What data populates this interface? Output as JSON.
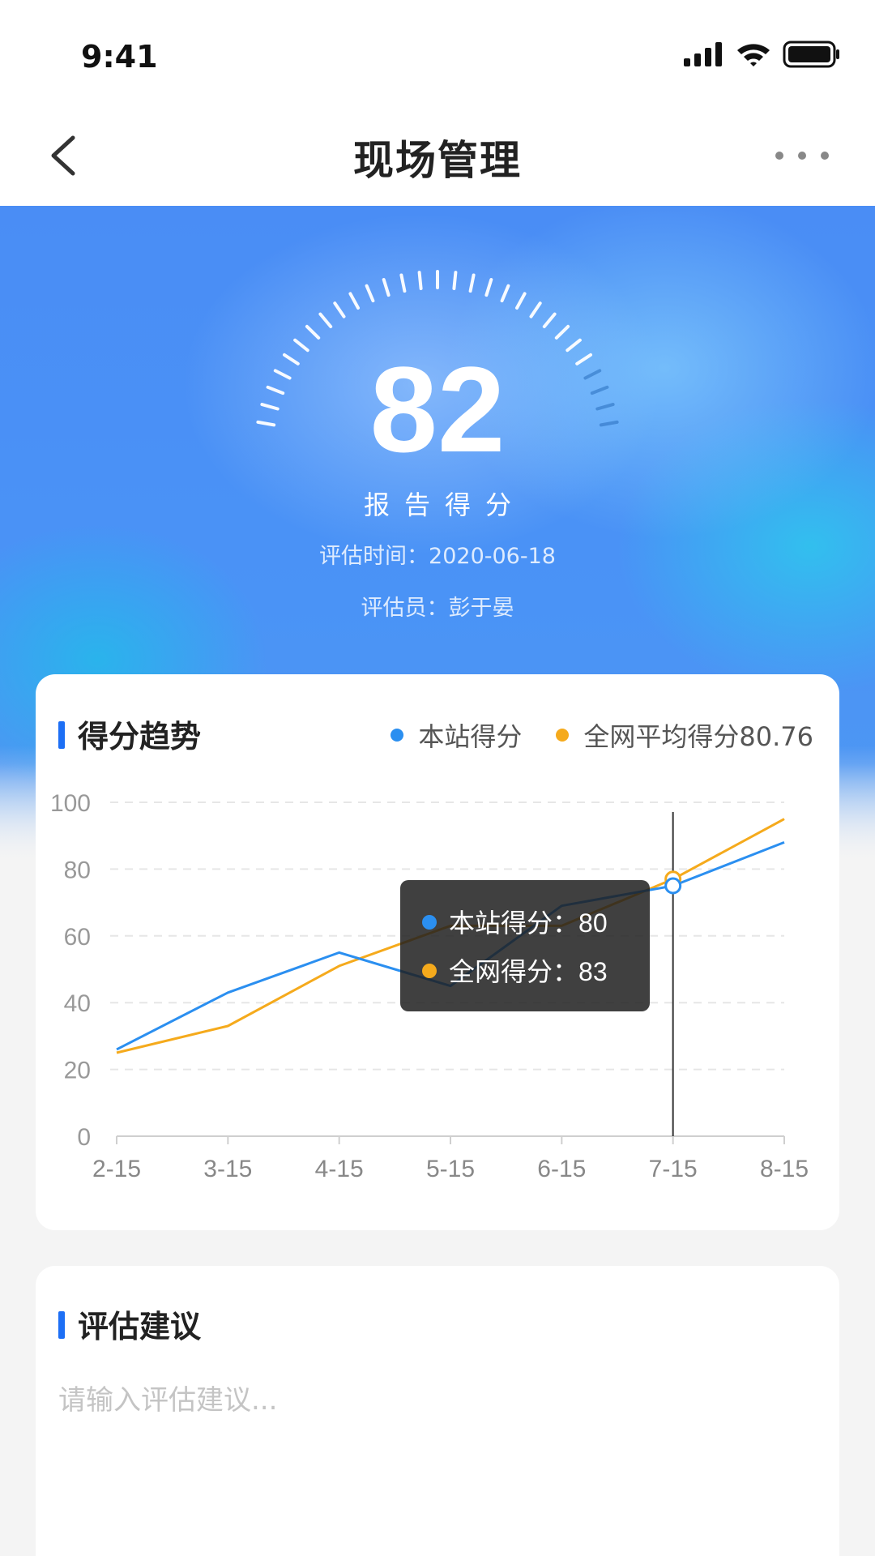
{
  "status_bar": {
    "time": "9:41"
  },
  "nav": {
    "title": "现场管理"
  },
  "hero": {
    "score": "82",
    "score_label": "报告得分",
    "eval_time": "评估时间：2020-06-18",
    "evaluator": "评估员：彭于晏"
  },
  "chart_card": {
    "title": "得分趋势",
    "legend": [
      {
        "label": "本站得分",
        "color": "#2b8ff0"
      },
      {
        "label": "全网平均得分80.76",
        "color": "#f5aa1c"
      }
    ]
  },
  "chart_data": {
    "type": "line",
    "x": [
      "2-15",
      "3-15",
      "4-15",
      "5-15",
      "6-15",
      "7-15",
      "8-15"
    ],
    "ylim": [
      0,
      100
    ],
    "yticks": [
      0,
      20,
      40,
      60,
      80,
      100
    ],
    "grid": true,
    "series": [
      {
        "name": "本站得分",
        "color": "#2b8ff0",
        "points": [
          [
            0,
            26
          ],
          [
            1,
            43
          ],
          [
            2,
            55
          ],
          [
            3,
            45
          ],
          [
            4,
            69
          ],
          [
            5,
            75
          ],
          [
            6,
            88
          ]
        ]
      },
      {
        "name": "全网平均得分80.76",
        "color": "#f5aa1c",
        "points": [
          [
            0,
            25
          ],
          [
            1,
            33
          ],
          [
            2,
            51
          ],
          [
            3,
            63
          ],
          [
            4,
            63
          ],
          [
            5,
            77
          ],
          [
            6,
            95
          ]
        ]
      }
    ],
    "crosshair_x_index": 5,
    "tooltip": {
      "rows": [
        {
          "label": "本站得分：",
          "value": "80",
          "color": "#2b8ff0"
        },
        {
          "label": "全网得分：",
          "value": "83",
          "color": "#f5aa1c"
        }
      ]
    }
  },
  "advice_card": {
    "title": "评估建议",
    "placeholder": "请输入评估建议..."
  }
}
